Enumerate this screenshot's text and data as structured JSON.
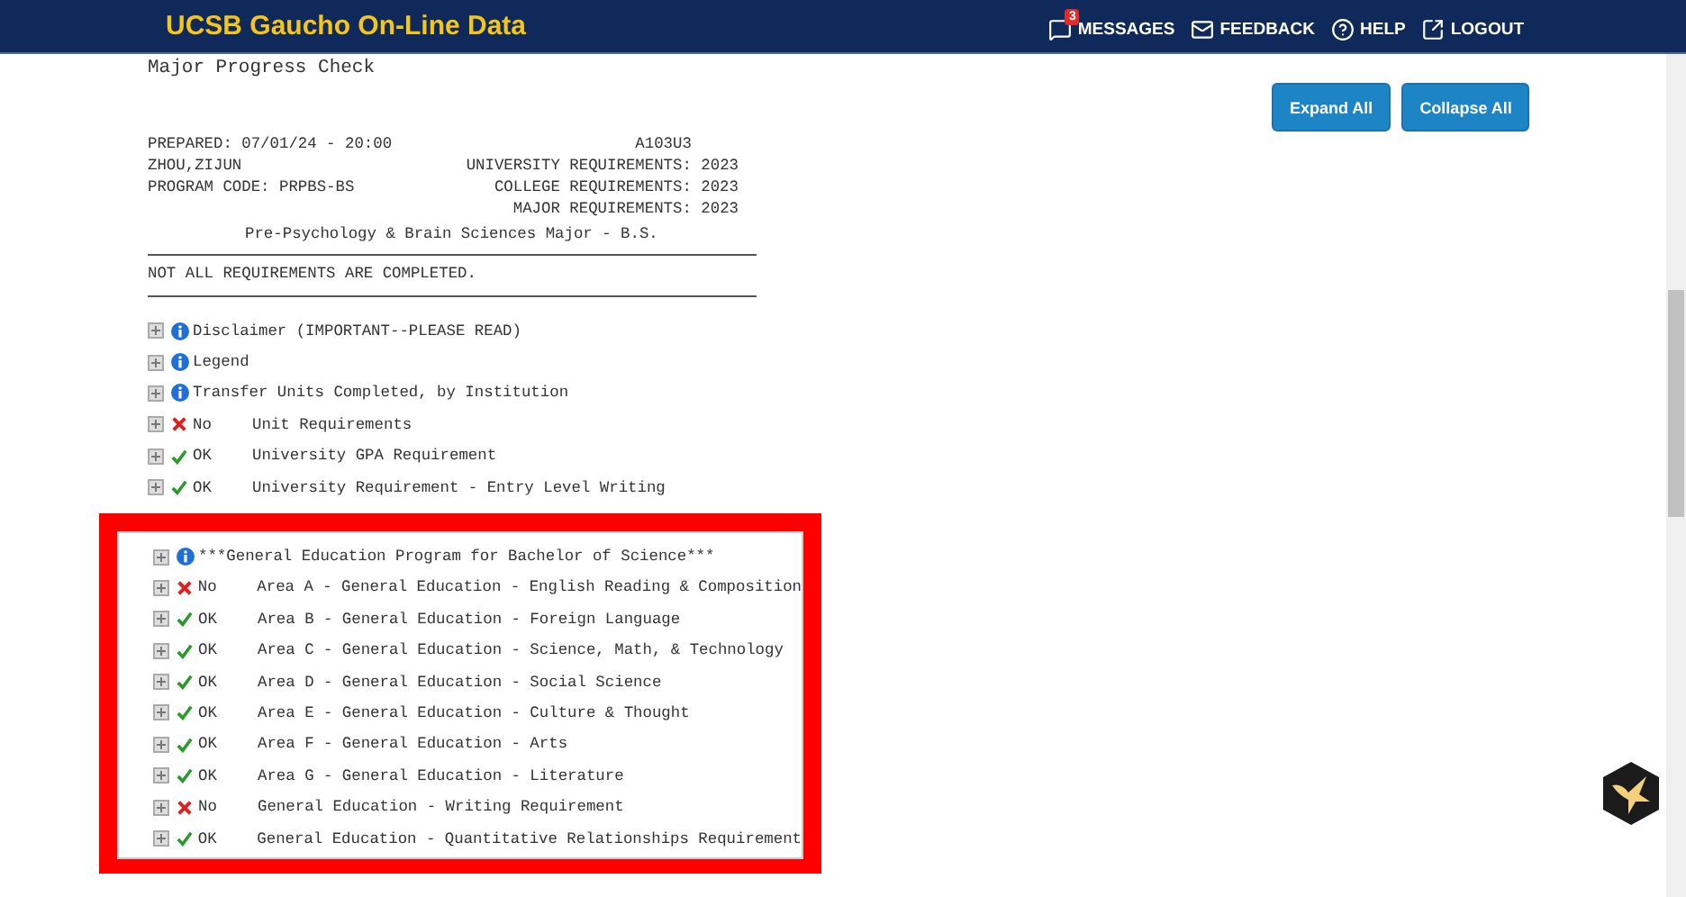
{
  "navbar": {
    "title": "UCSB Gaucho On-Line Data",
    "items": [
      {
        "label": "MESSAGES",
        "badge": "3"
      },
      {
        "label": "FEEDBACK"
      },
      {
        "label": "HELP"
      },
      {
        "label": "LOGOUT"
      }
    ]
  },
  "page_title": "Major Progress Check",
  "buttons": [
    "Expand All",
    "Collapse All"
  ],
  "report": {
    "lines": [
      {
        "left": "PREPARED: 07/01/24 - 20:00",
        "right": "A103U3     "
      },
      {
        "left": "ZHOU,ZIJUN",
        "right": "UNIVERSITY REQUIREMENTS: 2023"
      },
      {
        "left": "PROGRAM CODE: PRPBS-BS",
        "right": "COLLEGE REQUIREMENTS: 2023"
      },
      {
        "right": "MAJOR REQUIREMENTS: 2023"
      }
    ],
    "major": "Pre-Psychology & Brain Sciences Major - B.S.",
    "status_message": "NOT ALL REQUIREMENTS ARE COMPLETED."
  },
  "requirements": [
    {
      "kind": "info",
      "text": "Disclaimer (IMPORTANT--PLEASE READ)"
    },
    {
      "kind": "info",
      "text": "Legend"
    },
    {
      "kind": "info",
      "text": "Transfer Units Completed, by Institution"
    },
    {
      "kind": "check",
      "passed": false,
      "status": "No",
      "text": "Unit Requirements"
    },
    {
      "kind": "check",
      "passed": true,
      "status": "OK",
      "text": "University GPA Requirement"
    },
    {
      "kind": "check",
      "passed": true,
      "status": "OK",
      "text": "University Requirement - Entry Level Writing"
    }
  ],
  "highlighted_requirements": [
    {
      "kind": "info",
      "text": "***General Education Program for Bachelor of Science***"
    },
    {
      "kind": "check",
      "passed": false,
      "status": "No",
      "text": "Area A - General Education - English Reading & Composition"
    },
    {
      "kind": "check",
      "passed": true,
      "status": "OK",
      "text": "Area B - General Education - Foreign Language"
    },
    {
      "kind": "check",
      "passed": true,
      "status": "OK",
      "text": "Area C - General Education - Science, Math, & Technology"
    },
    {
      "kind": "check",
      "passed": true,
      "status": "OK",
      "text": "Area D - General Education - Social Science"
    },
    {
      "kind": "check",
      "passed": true,
      "status": "OK",
      "text": "Area E - General Education - Culture & Thought"
    },
    {
      "kind": "check",
      "passed": true,
      "status": "OK",
      "text": "Area F - General Education - Arts"
    },
    {
      "kind": "check",
      "passed": true,
      "status": "OK",
      "text": "Area G - General Education - Literature"
    },
    {
      "kind": "check",
      "passed": false,
      "status": "No",
      "text": "General Education - Writing Requirement"
    },
    {
      "kind": "check",
      "passed": true,
      "status": "OK",
      "text": "General Education - Quantitative Relationships Requirement"
    }
  ]
}
